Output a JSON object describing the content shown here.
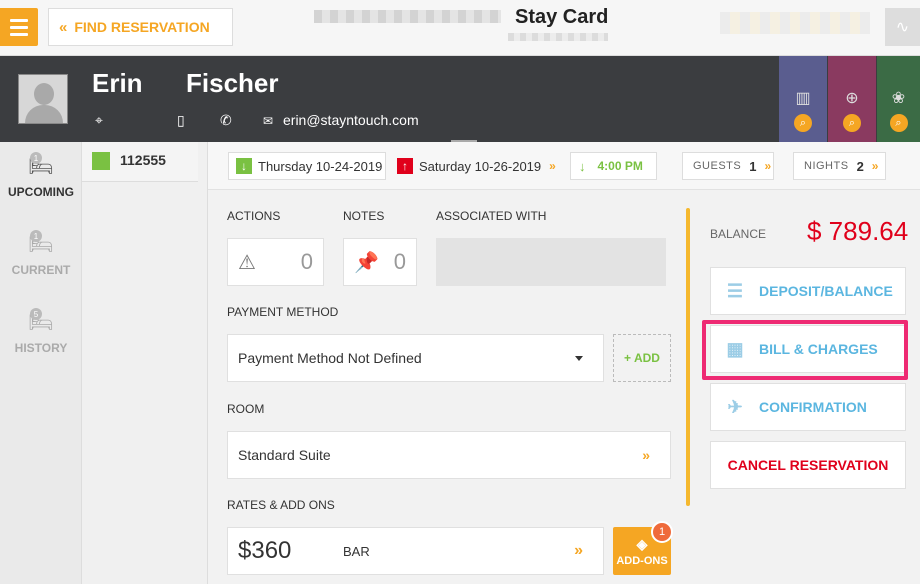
{
  "header": {
    "find_reservation_label": "FIND RESERVATION",
    "title": "Stay Card"
  },
  "guest": {
    "first_name": "Erin",
    "last_name": "Fischer",
    "email": "erin@stayntouch.com"
  },
  "sidebar": {
    "items": [
      {
        "label": "UPCOMING",
        "count": "1"
      },
      {
        "label": "CURRENT",
        "count": "1"
      },
      {
        "label": "HISTORY",
        "count": "5"
      }
    ]
  },
  "reservation": {
    "number": "112555"
  },
  "dates": {
    "arrival": "Thursday 10-24-2019",
    "departure": "Saturday 10-26-2019",
    "arrival_time": "4:00 PM",
    "guests_label": "GUESTS",
    "guests": "1",
    "nights_label": "NIGHTS",
    "nights": "2"
  },
  "main": {
    "actions_label": "ACTIONS",
    "actions_count": "0",
    "notes_label": "NOTES",
    "notes_count": "0",
    "associated_label": "ASSOCIATED WITH",
    "payment_label": "PAYMENT METHOD",
    "payment_value": "Payment Method Not Defined",
    "add_label": "+ ADD",
    "room_label": "ROOM",
    "room_value": "Standard Suite",
    "rates_label": "RATES & ADD ONS",
    "rate_amount": "$360",
    "rate_code": "BAR",
    "addons_label": "ADD-ONS",
    "addons_count": "1"
  },
  "right": {
    "balance_label": "BALANCE",
    "balance_amount": "$ 789.64",
    "deposit_label": "DEPOSIT/BALANCE",
    "bill_label": "BILL & CHARGES",
    "confirmation_label": "CONFIRMATION",
    "cancel_label": "CANCEL RESERVATION"
  },
  "colors": {
    "accent": "#f5a623",
    "header_bg": "#3b3d40",
    "balance_red": "#e0001b",
    "link_blue": "#5bb6e0",
    "highlight": "#ee2a73",
    "green": "#7ac142"
  }
}
